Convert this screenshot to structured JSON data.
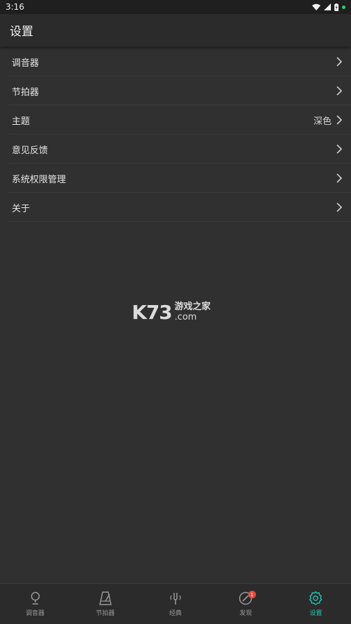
{
  "status_bar": {
    "time": "3:16"
  },
  "header": {
    "title": "设置"
  },
  "settings": {
    "items": [
      {
        "label": "调音器",
        "value": ""
      },
      {
        "label": "节拍器",
        "value": ""
      },
      {
        "label": "主题",
        "value": "深色"
      },
      {
        "label": "意见反馈",
        "value": ""
      },
      {
        "label": "系统权限管理",
        "value": ""
      },
      {
        "label": "关于",
        "value": ""
      }
    ]
  },
  "watermark": {
    "brand": "K73",
    "cn": "游戏之家",
    "domain": ".com"
  },
  "bottom_nav": {
    "items": [
      {
        "label": "调音器",
        "icon": "tuner-icon"
      },
      {
        "label": "节拍器",
        "icon": "metronome-icon"
      },
      {
        "label": "经典",
        "icon": "tuning-fork-icon"
      },
      {
        "label": "发现",
        "icon": "compass-icon",
        "badge": "1"
      },
      {
        "label": "设置",
        "icon": "gear-icon",
        "active": true
      }
    ]
  },
  "colors": {
    "accent": "#1ec8b4",
    "badge": "#e74c3c",
    "background": "#303030"
  }
}
